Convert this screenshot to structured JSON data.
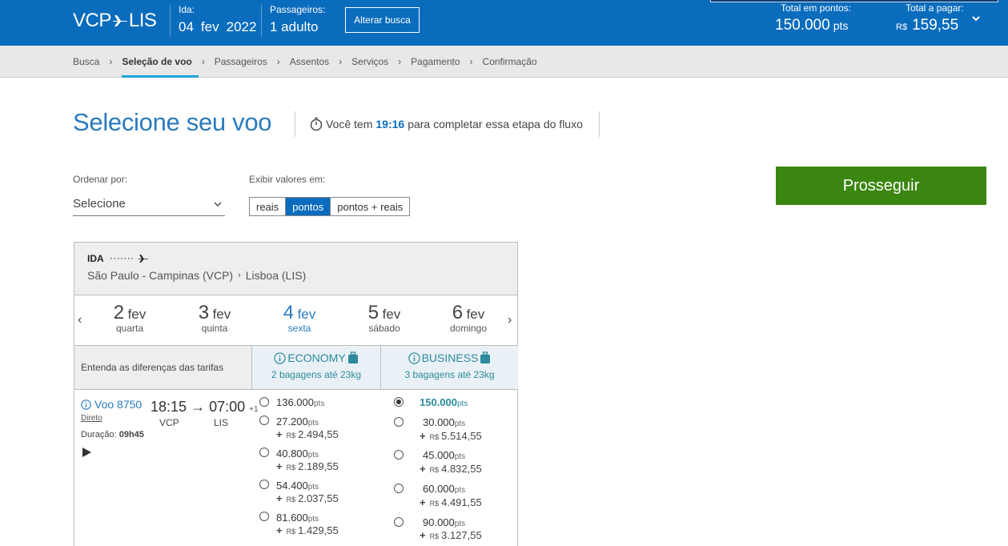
{
  "header": {
    "route_from": "VCP",
    "route_to": "LIS",
    "ida_label": "Ida:",
    "ida_day": "04",
    "ida_month": "fev",
    "ida_year": "2022",
    "passengers_label": "Passageiros:",
    "passengers_value": "1 adulto",
    "alter_button": "Alterar busca",
    "total_points_label": "Total em pontos:",
    "total_points_value": "150.000",
    "total_points_unit": "pts",
    "total_pay_label": "Total a pagar:",
    "total_pay_currency": "R$",
    "total_pay_value": "159,55"
  },
  "breadcrumb": [
    "Busca",
    "Seleção de voo",
    "Passageiros",
    "Assentos",
    "Serviços",
    "Pagamento",
    "Confirmação"
  ],
  "title": "Selecione seu voo",
  "timer": {
    "prefix": "Você tem",
    "time": "19:16",
    "suffix": "para completar essa etapa do fluxo"
  },
  "sort": {
    "label": "Ordenar por:",
    "value": "Selecione"
  },
  "display": {
    "label": "Exibir valores em:",
    "options": [
      "reais",
      "pontos",
      "pontos + reais"
    ],
    "selected": "pontos"
  },
  "proceed_button": "Prosseguir",
  "segment": {
    "title": "IDA",
    "origin": "São Paulo - Campinas (VCP)",
    "destination": "Lisboa (LIS)"
  },
  "dates": [
    {
      "day": "2",
      "month": "fev",
      "weekday": "quarta"
    },
    {
      "day": "3",
      "month": "fev",
      "weekday": "quinta"
    },
    {
      "day": "4",
      "month": "fev",
      "weekday": "sexta"
    },
    {
      "day": "5",
      "month": "fev",
      "weekday": "sábado"
    },
    {
      "day": "6",
      "month": "fev",
      "weekday": "domingo"
    }
  ],
  "selected_date_index": 2,
  "fare_header": {
    "left_text": "Entenda as diferenças das tarifas",
    "economy_name": "ECONOMY",
    "economy_bags": "2 bagagens até 23kg",
    "business_name": "BUSINESS",
    "business_bags": "3 bagagens até 23kg"
  },
  "flight": {
    "number": "Voo 8750",
    "type": "Direto",
    "duration_label": "Duração:",
    "duration_value": "09h45",
    "depart": "18:15",
    "arrive": "07:00",
    "day_offset": "+1",
    "origin_code": "VCP",
    "dest_code": "LIS"
  },
  "units": {
    "pts": "pts",
    "plus": "+",
    "currency": "R$"
  },
  "economy_options": [
    {
      "points": "136.000",
      "cash": ""
    },
    {
      "points": "27.200",
      "cash": "2.494,55"
    },
    {
      "points": "40.800",
      "cash": "2.189,55"
    },
    {
      "points": "54.400",
      "cash": "2.037,55"
    },
    {
      "points": "81.600",
      "cash": "1.429,55"
    }
  ],
  "business_options": [
    {
      "points": "150.000",
      "cash": "",
      "selected": true
    },
    {
      "points": "30.000",
      "cash": "5.514,55"
    },
    {
      "points": "45.000",
      "cash": "4.832,55"
    },
    {
      "points": "60.000",
      "cash": "4.491,55"
    },
    {
      "points": "90.000",
      "cash": "3.127,55"
    }
  ],
  "colors": {
    "header_blue": "#0a6cbd",
    "accent_teal": "#2b8a9c",
    "proceed_green": "#3b8610",
    "breadcrumb_underline": "#1aa5d8"
  }
}
